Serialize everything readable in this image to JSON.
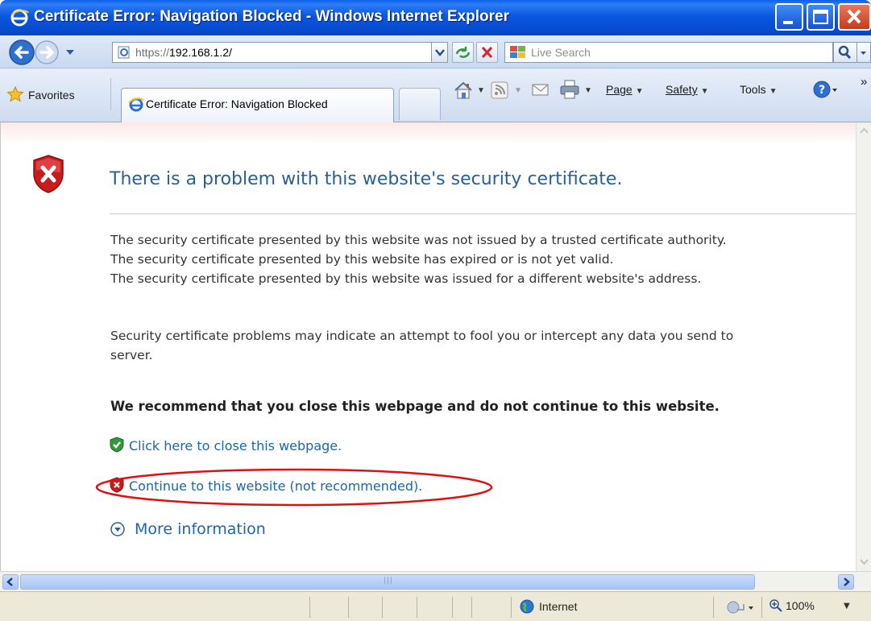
{
  "window": {
    "title": "Certificate Error: Navigation Blocked - Windows Internet Explorer"
  },
  "address": {
    "url_prefix": "https://",
    "url_host": "192.168.1.2/"
  },
  "search": {
    "placeholder": "Live Search"
  },
  "favorites_label": "Favorites",
  "tab": {
    "label": "Certificate Error: Navigation Blocked"
  },
  "command_bar": {
    "page": "Page",
    "safety": "Safety",
    "tools": "Tools"
  },
  "page": {
    "heading": "There is a problem with this website's security certificate.",
    "reasons": [
      "The security certificate presented by this website was not issued by a trusted certificate authority.",
      "The security certificate presented by this website has expired or is not yet valid.",
      "The security certificate presented by this website was issued for a different website's address."
    ],
    "warning_line1": "Security certificate problems may indicate an attempt to fool you or intercept any data you send to",
    "warning_line2": "server.",
    "recommendation": "We recommend that you close this webpage and do not continue to this website.",
    "close_link": "Click here to close this webpage.",
    "continue_link": "Continue to this website (not recommended).",
    "more_info": "More information"
  },
  "status_bar": {
    "zone": "Internet",
    "zoom": "100%"
  },
  "colors": {
    "titlebar": "#0b58df",
    "heading": "#2a5f94",
    "link": "#1c66a8",
    "highlight_ellipse": "#e01010"
  }
}
